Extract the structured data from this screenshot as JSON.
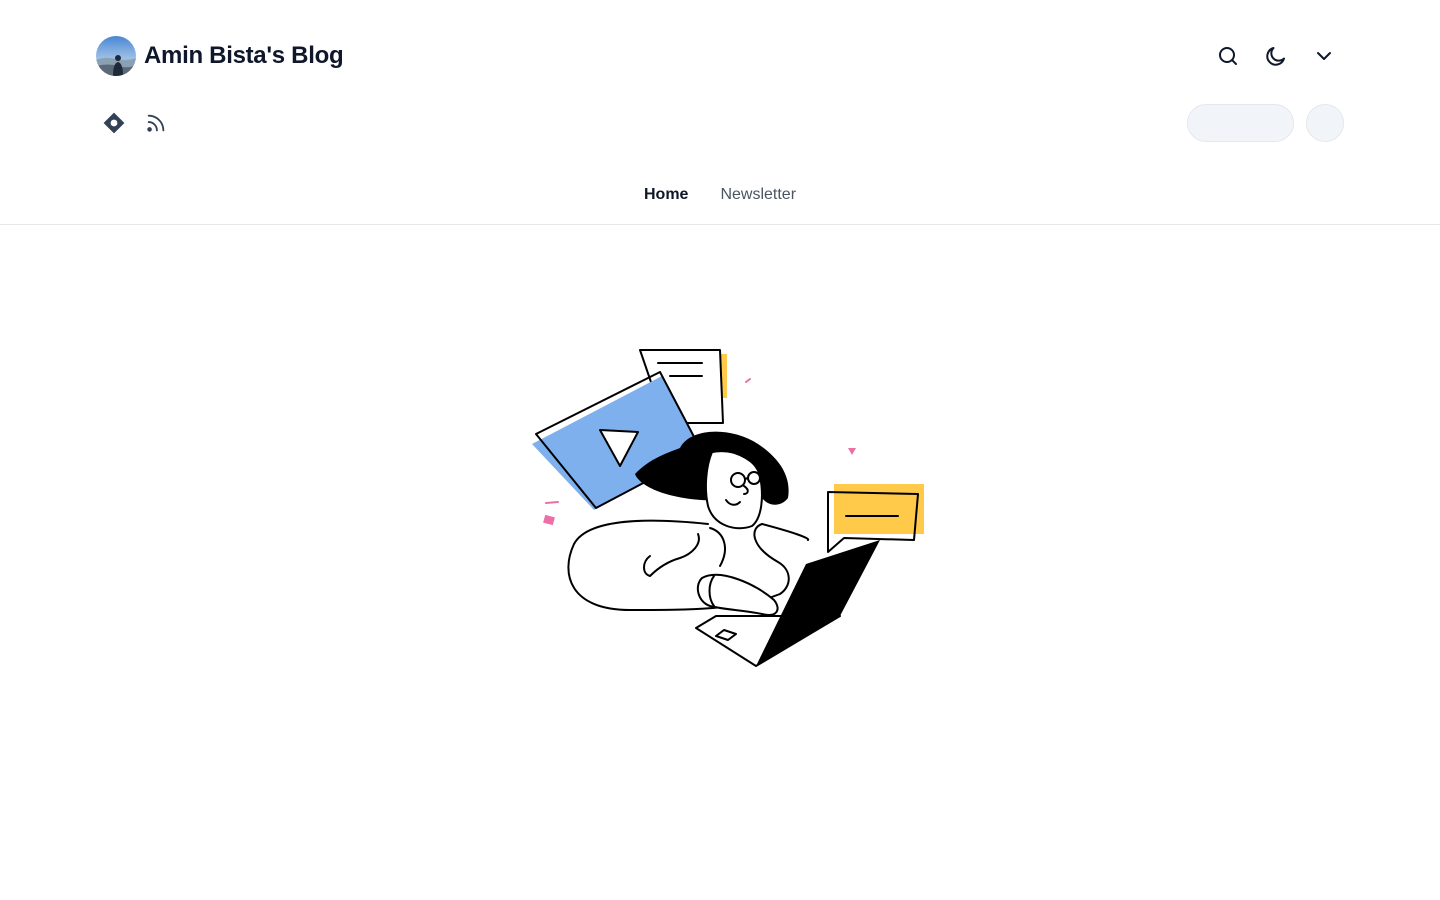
{
  "header": {
    "title": "Amin Bista's Blog",
    "actions": {
      "search": "search-icon",
      "theme": "moon-icon",
      "menu": "chevron-down-icon"
    },
    "social": [
      "hashnode-icon",
      "rss-icon"
    ]
  },
  "nav": {
    "items": [
      {
        "label": "Home",
        "active": true
      },
      {
        "label": "Newsletter",
        "active": false
      }
    ]
  },
  "colors": {
    "accent_blue": "#7eb0ee",
    "accent_yellow": "#ffc94a",
    "accent_pink": "#ec6fa6",
    "skeleton": "#f1f5f9",
    "text": "#0f172a",
    "muted": "#4b5563"
  }
}
